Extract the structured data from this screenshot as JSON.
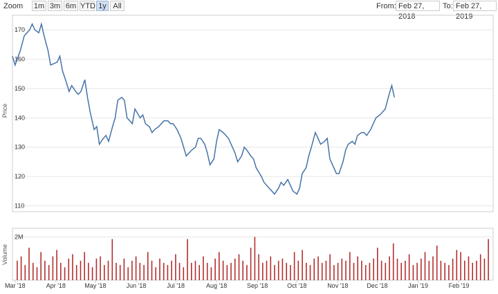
{
  "toolbar": {
    "zoom_label": "Zoom",
    "buttons": [
      "1m",
      "3m",
      "6m",
      "YTD",
      "1y",
      "All"
    ],
    "active": "1y",
    "from_label": "From:",
    "from_value": "Feb 27, 2018",
    "to_label": "To:",
    "to_value": "Feb 27, 2019"
  },
  "colors": {
    "price_line": "#4572a7",
    "volume_bar": "#b32d2d",
    "grid": "#e6e6e6",
    "frame": "#cccccc"
  },
  "chart_data": [
    {
      "type": "line",
      "ylabel": "Price",
      "ylim": [
        108,
        175
      ],
      "yticks": [
        "110",
        "120",
        "130",
        "140",
        "150",
        "160",
        "170"
      ],
      "grid": true,
      "x_dates": [
        "2018-02-27",
        "2018-03-01",
        "2018-03-05",
        "2018-03-08",
        "2018-03-12",
        "2018-03-14",
        "2018-03-16",
        "2018-03-19",
        "2018-03-21",
        "2018-03-23",
        "2018-03-26",
        "2018-03-28",
        "2018-04-02",
        "2018-04-04",
        "2018-04-06",
        "2018-04-09",
        "2018-04-11",
        "2018-04-13",
        "2018-04-16",
        "2018-04-18",
        "2018-04-20",
        "2018-04-23",
        "2018-04-25",
        "2018-04-27",
        "2018-04-30",
        "2018-05-02",
        "2018-05-04",
        "2018-05-07",
        "2018-05-09",
        "2018-05-11",
        "2018-05-14",
        "2018-05-16",
        "2018-05-18",
        "2018-05-21",
        "2018-05-23",
        "2018-05-25",
        "2018-05-29",
        "2018-05-31",
        "2018-06-04",
        "2018-06-06",
        "2018-06-08",
        "2018-06-11",
        "2018-06-13",
        "2018-06-15",
        "2018-06-18",
        "2018-06-20",
        "2018-06-22",
        "2018-06-25",
        "2018-06-27",
        "2018-06-29",
        "2018-07-02",
        "2018-07-05",
        "2018-07-09",
        "2018-07-11",
        "2018-07-13",
        "2018-07-16",
        "2018-07-18",
        "2018-07-20",
        "2018-07-23",
        "2018-07-25",
        "2018-07-27",
        "2018-07-30",
        "2018-08-01",
        "2018-08-03",
        "2018-08-06",
        "2018-08-08",
        "2018-08-10",
        "2018-08-13",
        "2018-08-15",
        "2018-08-17",
        "2018-08-20",
        "2018-08-22",
        "2018-08-24",
        "2018-08-27",
        "2018-08-29",
        "2018-08-31",
        "2018-09-04",
        "2018-09-06",
        "2018-09-10",
        "2018-09-12",
        "2018-09-14",
        "2018-09-17",
        "2018-09-19",
        "2018-09-21",
        "2018-09-24",
        "2018-09-26",
        "2018-09-28",
        "2018-10-01",
        "2018-10-03",
        "2018-10-05",
        "2018-10-08",
        "2018-10-10",
        "2018-10-12",
        "2018-10-15",
        "2018-10-17",
        "2018-10-19",
        "2018-10-22",
        "2018-10-24",
        "2018-10-26",
        "2018-10-29",
        "2018-10-31",
        "2018-11-02",
        "2018-11-05",
        "2018-11-07",
        "2018-11-09",
        "2018-11-12",
        "2018-11-14",
        "2018-11-16",
        "2018-11-19",
        "2018-11-21",
        "2018-11-23",
        "2018-11-26",
        "2018-11-28",
        "2018-11-30",
        "2018-12-03",
        "2018-12-05",
        "2018-12-07",
        "2018-12-10",
        "2018-12-12",
        "2018-12-14",
        "2018-12-17",
        "2018-12-19",
        "2018-12-21",
        "2018-12-24",
        "2018-12-27",
        "2018-12-31",
        "2019-01-02",
        "2019-01-04",
        "2019-01-08",
        "2019-01-10",
        "2019-01-14",
        "2019-01-16",
        "2019-01-18",
        "2019-01-22",
        "2019-01-24",
        "2019-01-28",
        "2019-01-30",
        "2019-02-01",
        "2019-02-05",
        "2019-02-07",
        "2019-02-11",
        "2019-02-13",
        "2019-02-15",
        "2019-02-19",
        "2019-02-21",
        "2019-02-25",
        "2019-02-27"
      ],
      "x_ticks": [
        "Mar '18",
        "Apr '18",
        "May '18",
        "Jun '18",
        "Jul '18",
        "Aug '18",
        "Sep '18",
        "Oct '18",
        "Nov '18",
        "Dec '18",
        "Jan '19",
        "Feb '19"
      ],
      "x_tick_dates": [
        "2018-03-01",
        "2018-04-01",
        "2018-05-01",
        "2018-06-01",
        "2018-07-01",
        "2018-08-01",
        "2018-09-01",
        "2018-10-01",
        "2018-11-01",
        "2018-12-01",
        "2019-01-01",
        "2019-02-01"
      ],
      "series": [
        {
          "values": [
            161,
            158,
            163,
            168,
            170,
            172,
            170,
            169,
            172,
            168,
            163,
            158,
            159,
            161,
            156,
            152,
            149,
            151,
            149,
            148,
            149,
            153,
            147,
            142,
            136,
            137,
            131,
            133,
            134,
            132,
            137,
            140,
            146,
            147,
            146,
            140,
            138,
            143,
            140,
            141,
            138,
            137,
            135,
            136,
            137,
            138,
            139,
            139,
            138,
            138,
            136,
            133,
            127,
            128,
            129,
            130,
            133,
            133,
            131,
            128,
            124,
            126,
            132,
            136,
            135,
            134,
            133,
            130,
            128,
            125,
            127,
            130,
            129,
            127,
            126,
            123,
            120,
            118,
            116,
            115,
            114,
            116,
            118,
            117,
            119,
            117,
            115,
            114,
            116,
            121,
            123,
            127,
            130,
            135,
            133,
            131,
            132,
            133,
            126,
            123,
            121,
            121,
            125,
            129,
            131,
            132,
            131,
            134,
            135,
            135,
            134,
            136,
            138,
            140,
            141,
            142,
            143,
            148,
            151,
            147
          ]
        }
      ]
    },
    {
      "type": "bar",
      "ylabel": "Volume",
      "yticks": [
        "2M"
      ],
      "ylim": [
        0,
        2400000
      ],
      "series": [
        {
          "values": [
            900000,
            1100000,
            700000,
            1500000,
            800000,
            600000,
            1300000,
            900000,
            700000,
            1100000,
            1400000,
            800000,
            600000,
            1000000,
            1200000,
            700000,
            900000,
            1300000,
            800000,
            600000,
            1000000,
            1100000,
            700000,
            900000,
            1900000,
            800000,
            700000,
            1000000,
            600000,
            900000,
            1100000,
            800000,
            700000,
            1300000,
            900000,
            600000,
            1000000,
            800000,
            700000,
            900000,
            1200000,
            800000,
            600000,
            1900000,
            800000,
            900000,
            700000,
            1100000,
            800000,
            600000,
            1000000,
            1300000,
            900000,
            700000,
            800000,
            1000000,
            1200000,
            900000,
            700000,
            1500000,
            2000000,
            1200000,
            800000,
            900000,
            1100000,
            700000,
            900000,
            1000000,
            800000,
            700000,
            1300000,
            900000,
            1400000,
            800000,
            700000,
            1000000,
            1100000,
            800000,
            900000,
            1200000,
            700000,
            800000,
            1000000,
            900000,
            1300000,
            800000,
            1100000,
            900000,
            700000,
            800000,
            1000000,
            1500000,
            900000,
            800000,
            1100000,
            1700000,
            1000000,
            800000,
            900000,
            1200000,
            700000,
            800000,
            1000000,
            1300000,
            900000,
            1100000,
            1600000,
            900000,
            800000,
            700000,
            1000000,
            1400000,
            1300000,
            900000,
            1100000,
            800000,
            900000,
            1200000,
            1000000,
            1900000
          ]
        }
      ]
    }
  ]
}
